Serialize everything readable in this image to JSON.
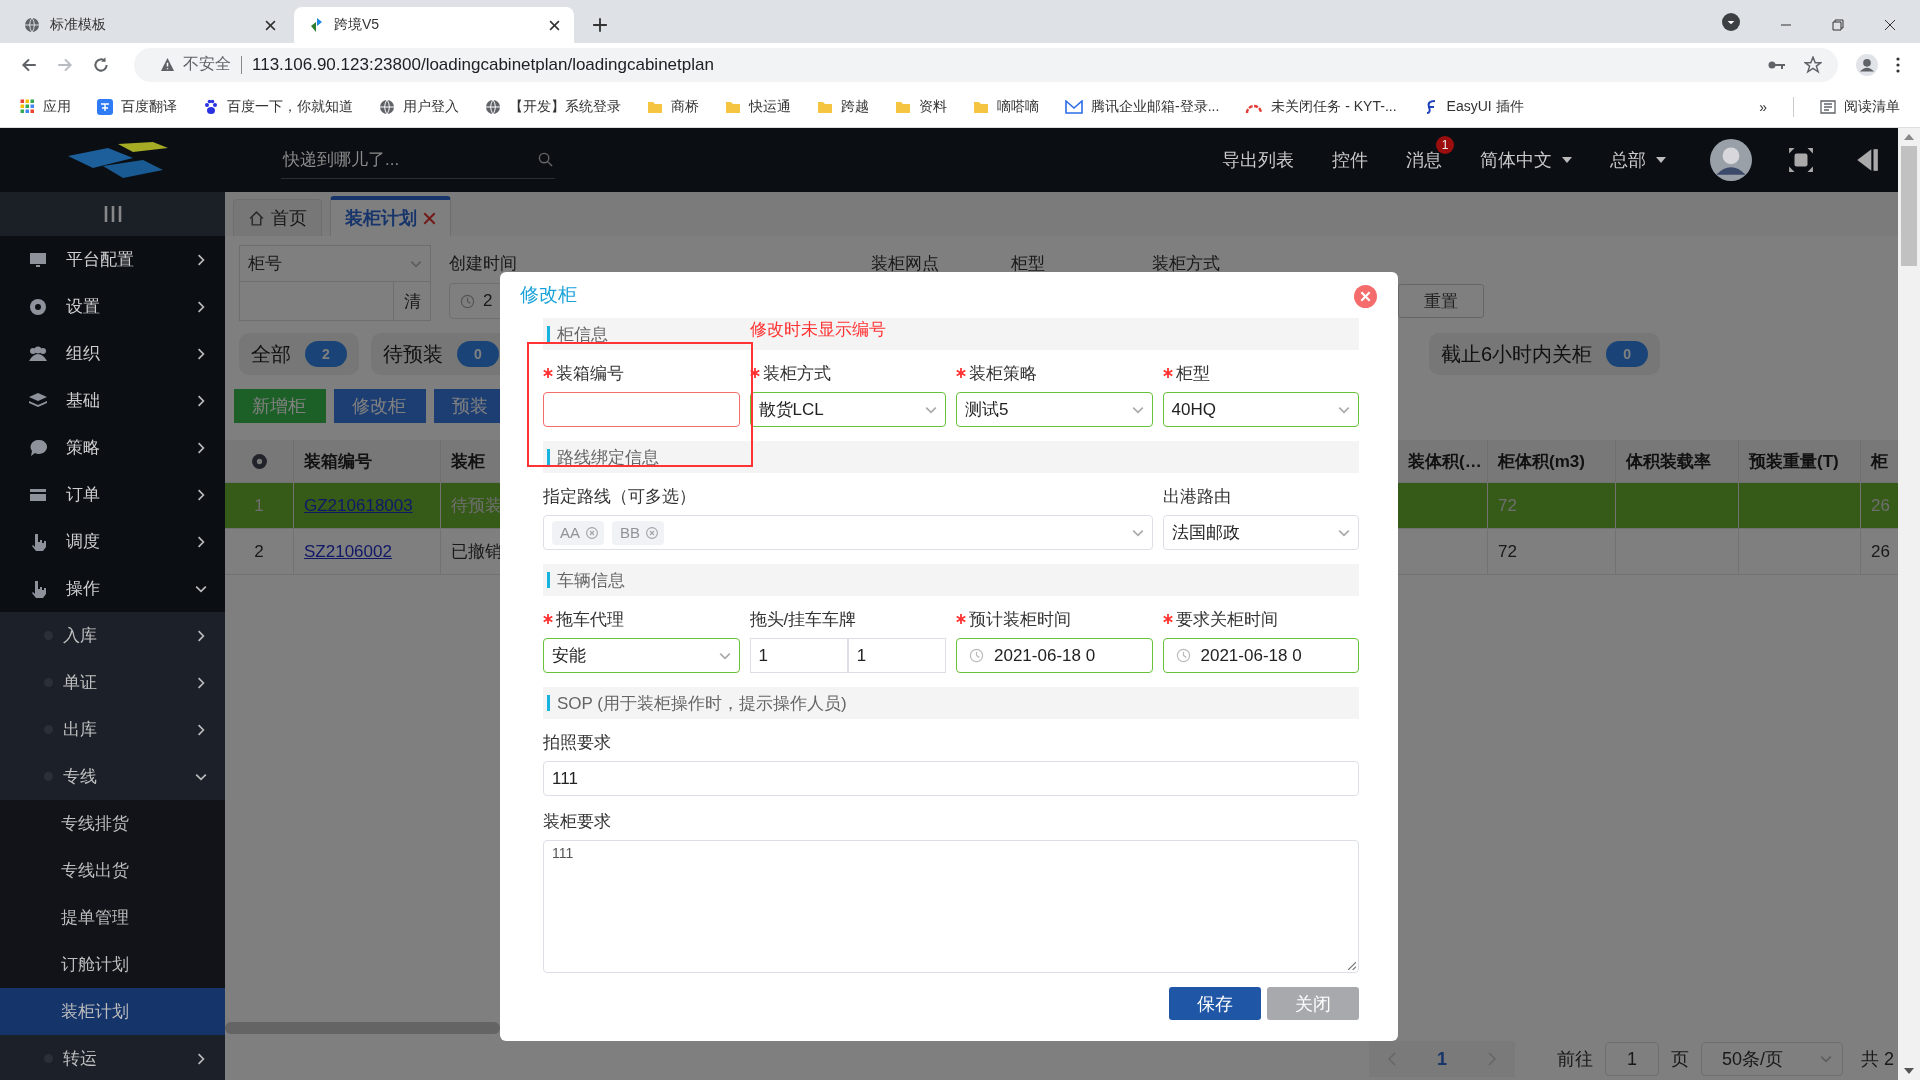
{
  "browser": {
    "tabs": [
      {
        "title": "标准模板",
        "selected": false
      },
      {
        "title": "跨境V5",
        "selected": true
      }
    ],
    "security_label": "不安全",
    "url": "113.106.90.123:23800/loadingcabinetplan/loadingcabinetplan",
    "bookmarks": [
      {
        "label": "应用",
        "kind": "apps"
      },
      {
        "label": "百度翻译",
        "kind": "translate"
      },
      {
        "label": "百度一下，你就知道",
        "kind": "paw"
      },
      {
        "label": "用户登入",
        "kind": "site"
      },
      {
        "label": "【开发】系统登录",
        "kind": "site"
      },
      {
        "label": "商桥",
        "kind": "folder"
      },
      {
        "label": "快运通",
        "kind": "folder"
      },
      {
        "label": "跨越",
        "kind": "folder"
      },
      {
        "label": "资料",
        "kind": "folder"
      },
      {
        "label": "嘀嗒嘀",
        "kind": "folder"
      },
      {
        "label": "腾讯企业邮箱-登录...",
        "kind": "mail"
      },
      {
        "label": "未关闭任务 - KYT-...",
        "kind": "arc"
      },
      {
        "label": "EasyUI 插件",
        "kind": "script"
      }
    ],
    "more": "»",
    "reading_list": "阅读清单"
  },
  "header": {
    "search_placeholder": "快递到哪儿了...",
    "links": [
      {
        "label": "导出列表",
        "dropdown": false
      },
      {
        "label": "控件",
        "dropdown": false
      },
      {
        "label": "消息",
        "badge": "1",
        "dropdown": false
      },
      {
        "label": "简体中文",
        "dropdown": true
      },
      {
        "label": "总部",
        "dropdown": true
      }
    ]
  },
  "sidebar": {
    "items": [
      {
        "label": "平台配置",
        "selected": false,
        "expanded": false
      },
      {
        "label": "设置",
        "selected": false,
        "expanded": false
      },
      {
        "label": "组织",
        "selected": false,
        "expanded": false
      },
      {
        "label": "基础",
        "selected": false,
        "expanded": false
      },
      {
        "label": "策略",
        "selected": false,
        "expanded": false
      },
      {
        "label": "订单",
        "selected": false,
        "expanded": false
      },
      {
        "label": "调度",
        "selected": false,
        "expanded": false
      },
      {
        "label": "操作",
        "selected": false,
        "expanded": true,
        "children": [
          {
            "label": "入库",
            "selected": false,
            "expanded": false
          },
          {
            "label": "单证",
            "selected": false,
            "expanded": false
          },
          {
            "label": "出库",
            "selected": false,
            "expanded": false
          },
          {
            "label": "专线",
            "selected": false,
            "expanded": true,
            "children": [
              {
                "label": "专线排货",
                "selected": false
              },
              {
                "label": "专线出货",
                "selected": false
              },
              {
                "label": "提单管理",
                "selected": false
              },
              {
                "label": "订舱计划",
                "selected": false
              },
              {
                "label": "装柜计划",
                "selected": true
              }
            ]
          },
          {
            "label": "转运",
            "selected": false,
            "expanded": false
          }
        ]
      }
    ]
  },
  "tabs": [
    {
      "label": "首页",
      "kind": "home",
      "selected": false,
      "closable": false
    },
    {
      "label": "装柜计划",
      "kind": "page",
      "selected": true,
      "closable": true
    }
  ],
  "filters": {
    "select_label": "柜号",
    "clear_button": "清",
    "date_value": "2",
    "labels": [
      "创建时间",
      "装柜网点",
      "柜型",
      "装柜方式"
    ],
    "reset_button": "重置"
  },
  "chips_left": [
    {
      "label": "全部",
      "count": "2"
    },
    {
      "label": "待预装",
      "count": "0"
    }
  ],
  "chips_right": [
    {
      "label": "截止6小时内关柜",
      "count": "0"
    }
  ],
  "actions": [
    {
      "label": "新增柜",
      "kind": "success"
    },
    {
      "label": "修改柜",
      "kind": "primary"
    },
    {
      "label": "预装",
      "kind": "primary"
    }
  ],
  "table": {
    "columns": [
      {
        "kind": "settings"
      },
      {
        "label": "装箱编号"
      },
      {
        "label": "装柜"
      },
      {
        "kind": "gap"
      },
      {
        "label": "装体积(…"
      },
      {
        "label": "柜体积(m3)"
      },
      {
        "label": "体积装载率"
      },
      {
        "label": "预装重量(T)"
      },
      {
        "label": "柜"
      }
    ],
    "rows": [
      {
        "selected": true,
        "index": "1",
        "code": "GZ210618003",
        "status": "待预装",
        "cabinet_volume": "72",
        "column_9": "26"
      },
      {
        "selected": false,
        "index": "2",
        "code": "SZ2106002",
        "status": "已撤销",
        "cabinet_volume": "72",
        "column_9": "26"
      }
    ]
  },
  "pagination": {
    "current": "1",
    "goto_label": "前往",
    "goto_value": "1",
    "page_label": "页",
    "page_size": "50条/页",
    "total": "共 2"
  },
  "dialog": {
    "title": "修改柜",
    "note": "修改时未显示编号",
    "sections": [
      {
        "title": "柜信息",
        "fields": [
          {
            "label": "装箱编号",
            "kind": "text",
            "required": true,
            "invalid": true
          },
          {
            "label": "装柜方式",
            "kind": "select",
            "required": true,
            "invalid": false,
            "valid": true,
            "value": "散货LCL"
          },
          {
            "label": "装柜策略",
            "kind": "select",
            "required": true,
            "invalid": false,
            "valid": true,
            "value": "测试5"
          },
          {
            "label": "柜型",
            "kind": "select",
            "required": true,
            "invalid": false,
            "valid": true,
            "value": "40HQ"
          }
        ]
      },
      {
        "title": "路线绑定信息",
        "fields": [
          {
            "label": "指定路线（可多选）",
            "kind": "tags",
            "required": false,
            "invalid": false,
            "valid": false,
            "tags": [
              "AA",
              "BB"
            ]
          },
          {
            "label": "出港路由",
            "kind": "select",
            "required": false,
            "invalid": false,
            "valid": false,
            "value": "法国邮政"
          }
        ]
      },
      {
        "title": "车辆信息",
        "fields": [
          {
            "label": "拖车代理",
            "kind": "select",
            "required": true,
            "invalid": false,
            "valid": true,
            "value": "安能"
          },
          {
            "label": "拖头/挂车车牌",
            "kind": "plates",
            "required": false,
            "invalid": false,
            "valid": false,
            "values": [
              "1",
              "1"
            ]
          },
          {
            "label": "预计装柜时间",
            "kind": "date",
            "required": true,
            "invalid": false,
            "valid": true,
            "value": "2021-06-18 0"
          },
          {
            "label": "要求关柜时间",
            "kind": "date",
            "required": true,
            "invalid": false,
            "valid": true,
            "value": "2021-06-18 0"
          }
        ]
      },
      {
        "title": "SOP (用于装柜操作时，提示操作人员)",
        "fields": [
          {
            "label": "拍照要求",
            "kind": "line",
            "required": false,
            "invalid": false,
            "valid": false,
            "value": "111"
          },
          {
            "label": "装柜要求",
            "kind": "textarea",
            "required": false,
            "invalid": false,
            "valid": false,
            "value": "111"
          }
        ]
      }
    ],
    "buttons": [
      {
        "label": "保存",
        "kind": "primary"
      },
      {
        "label": "关闭",
        "kind": "secondary"
      }
    ]
  }
}
